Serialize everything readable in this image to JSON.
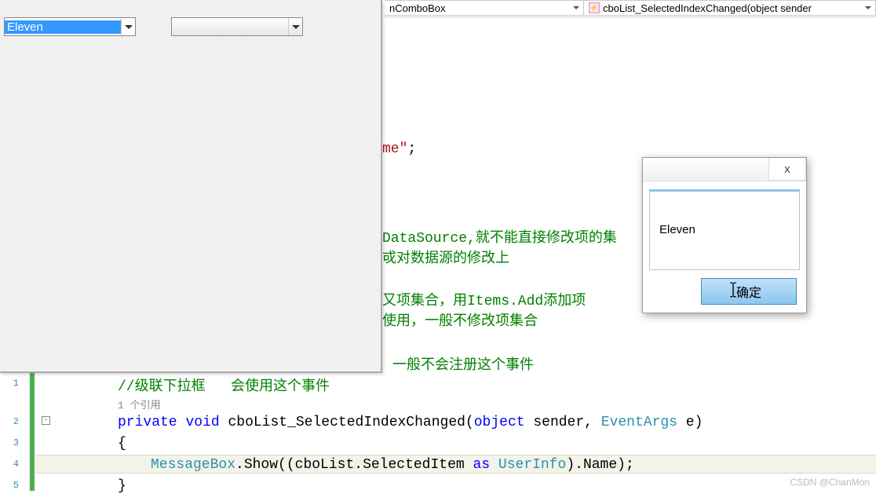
{
  "nav": {
    "combo1": "nComboBox",
    "combo2": "cboList_SelectedIndexChanged(object sender"
  },
  "form": {
    "combo1_value": "Eleven",
    "combo2_value": ""
  },
  "dialog": {
    "message": "Eleven",
    "ok_label": "确定"
  },
  "code": {
    "line_nums": {
      "l1": "1",
      "l2": "2",
      "l3": "3",
      "l4": "4",
      "l5": "5"
    },
    "fold_minus": "-",
    "frag_me": "me\"",
    "frag_semicolon": ";",
    "comment_ds1": "DataSource,就不能直接修改项的集",
    "comment_ds2": "戓对数据源的修改上",
    "comment_items1": "又项集合，用Items.Add添加项",
    "comment_items2": "使用，一般不修改项集合",
    "comment_noevent": "一般不会注册这个事件",
    "comment_cascade": "//级联下拉框   会使用这个事件",
    "ref_label": "1 个引用",
    "kw_private": "private",
    "kw_void": "void",
    "method_name": "cboList_SelectedIndexChanged",
    "paren_open": "(",
    "kw_object": "object",
    "param_sender": " sender, ",
    "type_eventargs": "EventArgs",
    "param_e": " e)",
    "brace_open": "{",
    "mb_class": "MessageBox",
    "mb_dot_show": ".Show",
    "mb_args1": "((cboList.SelectedItem ",
    "kw_as": "as",
    "sp": " ",
    "type_userinfo": "UserInfo",
    "mb_args2": ").Name)",
    "mb_semi": ";",
    "brace_close": "}"
  },
  "watermark": "CSDN @ChanMon"
}
